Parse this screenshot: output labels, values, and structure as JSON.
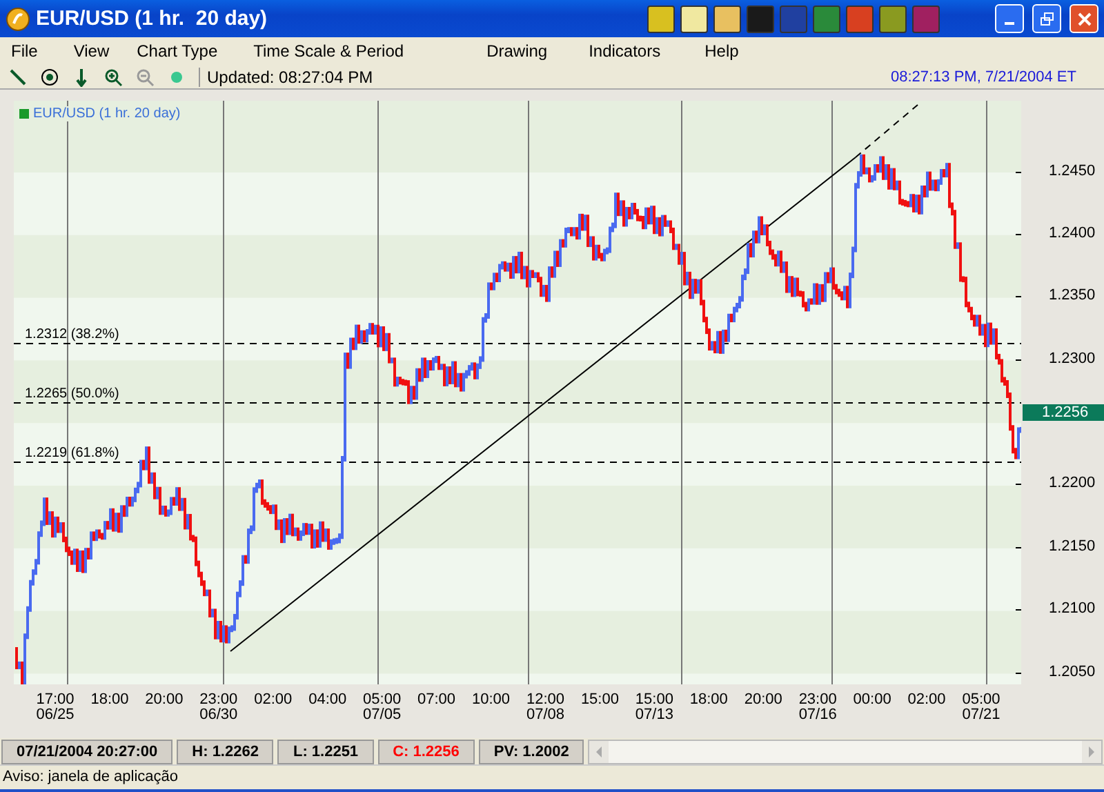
{
  "window": {
    "title": "EUR/USD (1 hr.  20 day)"
  },
  "menu": [
    "File",
    "View",
    "Chart Type",
    "Time Scale & Period",
    "Drawing",
    "Indicators",
    "Help"
  ],
  "toolbar": {
    "updated": "Updated: 08:27:04 PM",
    "clock": "08:27:13 PM, 7/21/2004 ET"
  },
  "chart": {
    "label": "EUR/USD (1 hr.  20 day)",
    "y_ticks": [
      "1.2450",
      "1.2400",
      "1.2350",
      "1.2300",
      "1.2200",
      "1.2150",
      "1.2100",
      "1.2050"
    ],
    "price_tag": "1.2256",
    "fib_levels": [
      "1.2312 (38.2%)",
      "1.2265 (50.0%)",
      "1.2219 (61.8%)"
    ],
    "x_labels": [
      {
        "time": "17:00",
        "date": "06/25"
      },
      {
        "time": "18:00"
      },
      {
        "time": "20:00"
      },
      {
        "time": "23:00",
        "date": "06/30"
      },
      {
        "time": "02:00"
      },
      {
        "time": "04:00"
      },
      {
        "time": "05:00",
        "date": "07/05"
      },
      {
        "time": "07:00"
      },
      {
        "time": "10:00"
      },
      {
        "time": "12:00",
        "date": "07/08"
      },
      {
        "time": "15:00"
      },
      {
        "time": "15:00",
        "date": "07/13"
      },
      {
        "time": "18:00"
      },
      {
        "time": "20:00"
      },
      {
        "time": "23:00",
        "date": "07/16"
      },
      {
        "time": "00:00"
      },
      {
        "time": "02:00"
      },
      {
        "time": "05:00",
        "date": "07/21"
      }
    ]
  },
  "status_cells": [
    {
      "text": "07/21/2004 20:27:00",
      "color": "#000000"
    },
    {
      "text": "H: 1.2262",
      "color": "#000000"
    },
    {
      "text": "L: 1.2251",
      "color": "#000000"
    },
    {
      "text": "C: 1.2256",
      "color": "#ff0000"
    },
    {
      "text": "PV: 1.2002",
      "color": "#000000"
    }
  ],
  "status_bar": "Aviso: janela de aplicação"
}
